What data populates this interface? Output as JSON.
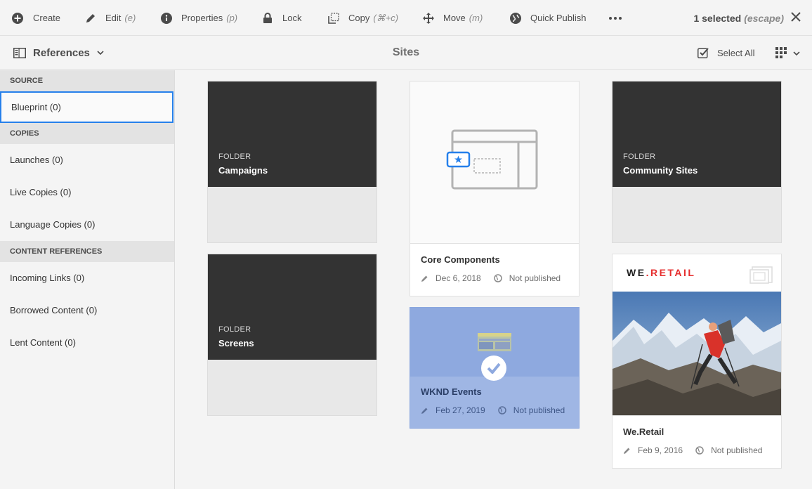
{
  "actionbar": {
    "create": "Create",
    "edit": "Edit",
    "edit_shortcut": "(e)",
    "properties": "Properties",
    "properties_shortcut": "(p)",
    "lock": "Lock",
    "copy": "Copy",
    "copy_shortcut": "(⌘+c)",
    "move": "Move",
    "move_shortcut": "(m)",
    "quick_publish": "Quick Publish",
    "selected_count": "1 selected",
    "escape_hint": "(escape)"
  },
  "titlebar": {
    "rail_label": "References",
    "title": "Sites",
    "select_all": "Select All"
  },
  "rail": {
    "source_heading": "SOURCE",
    "blueprint": "Blueprint (0)",
    "copies_heading": "COPIES",
    "launches": "Launches (0)",
    "live_copies": "Live Copies (0)",
    "language_copies": "Language Copies (0)",
    "content_heading": "CONTENT REFERENCES",
    "incoming_links": "Incoming Links (0)",
    "borrowed_content": "Borrowed Content (0)",
    "lent_content": "Lent Content (0)"
  },
  "cards": {
    "campaigns": {
      "kind": "FOLDER",
      "name": "Campaigns"
    },
    "screens": {
      "kind": "FOLDER",
      "name": "Screens"
    },
    "community": {
      "kind": "FOLDER",
      "name": "Community Sites"
    },
    "core": {
      "title": "Core Components",
      "date": "Dec 6, 2018",
      "status": "Not published"
    },
    "wknd": {
      "title": "WKND Events",
      "date": "Feb 27, 2019",
      "status": "Not published",
      "selected": true
    },
    "weretail": {
      "logo_a": "WE",
      "logo_dot": ".",
      "logo_b": "RETAIL",
      "title": "We.Retail",
      "date": "Feb 9, 2016",
      "status": "Not published"
    }
  },
  "colors": {
    "accent": "#2680eb",
    "folder_bg": "#333333",
    "selected_bg": "#9fb6e4",
    "brand_red": "#e62e2e"
  }
}
